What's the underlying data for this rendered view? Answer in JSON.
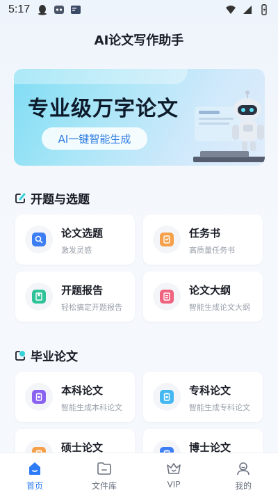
{
  "status_bar": {
    "time": "5:17"
  },
  "app_title": "AI论文写作助手",
  "banner": {
    "headline": "专业级万字论文",
    "pill": "AI一键智能生成"
  },
  "sections": [
    {
      "title": "开题与选题",
      "cards": [
        {
          "title": "论文选题",
          "subtitle": "激发灵感",
          "icon": "search-icon",
          "color": "#3d7ef5"
        },
        {
          "title": "任务书",
          "subtitle": "高质量任务书",
          "icon": "task-icon",
          "color": "#f5a04a"
        },
        {
          "title": "开题报告",
          "subtitle": "轻松搞定开题报告",
          "icon": "report-icon",
          "color": "#2fc39a"
        },
        {
          "title": "论文大纲",
          "subtitle": "智能生成论文大纲",
          "icon": "outline-icon",
          "color": "#f0637f"
        }
      ]
    },
    {
      "title": "毕业论文",
      "cards": [
        {
          "title": "本科论文",
          "subtitle": "智能生成本科论文",
          "icon": "bachelor-icon",
          "color": "#8b63f1"
        },
        {
          "title": "专科论文",
          "subtitle": "智能生成专科论文",
          "icon": "junior-college-icon",
          "color": "#45b8f2"
        },
        {
          "title": "硕士论文",
          "subtitle": "",
          "icon": "master-icon",
          "color": "#f5a04a"
        },
        {
          "title": "博士论文",
          "subtitle": "",
          "icon": "doctor-icon",
          "color": "#3d7ef5"
        }
      ]
    }
  ],
  "tab_bar": {
    "items": [
      {
        "label": "首页",
        "icon": "home-icon",
        "active": true
      },
      {
        "label": "文件库",
        "icon": "folder-icon",
        "active": false
      },
      {
        "label": "VIP",
        "icon": "crown-icon",
        "active": false
      },
      {
        "label": "我的",
        "icon": "profile-icon",
        "active": false
      }
    ]
  },
  "colors": {
    "accent": "#2d7cf6",
    "background": "#f5f8fc"
  }
}
